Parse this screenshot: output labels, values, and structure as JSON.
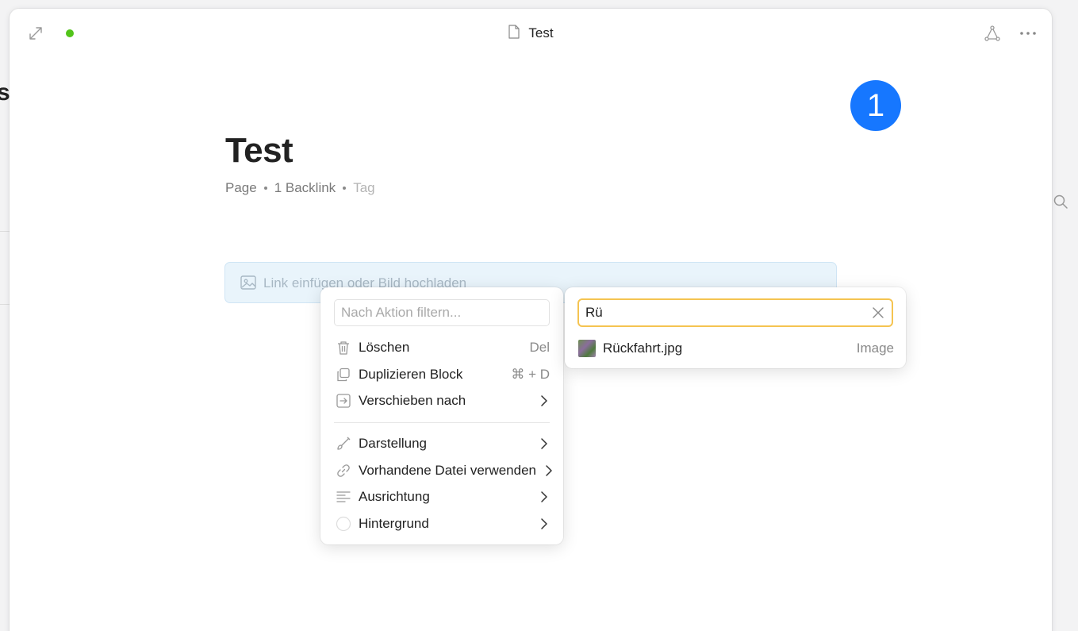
{
  "background": {
    "left_fragment": "st"
  },
  "window": {
    "title": "Test",
    "icons": {
      "expand": "expand-icon",
      "document": "document-icon",
      "graph": "graph-icon",
      "more": "more-icon"
    },
    "sync_status_color": "#52c41a"
  },
  "step_badge": "1",
  "page": {
    "title": "Test",
    "meta": {
      "type": "Page",
      "backlinks": "1 Backlink",
      "tag": "Tag"
    }
  },
  "image_block": {
    "placeholder": "Link einfügen oder Bild hochladen"
  },
  "context_menu": {
    "filter_placeholder": "Nach Aktion filtern...",
    "items": [
      {
        "label": "Löschen",
        "shortcut": "Del",
        "icon": "trash-icon"
      },
      {
        "label": "Duplizieren Block",
        "shortcut": "⌘ + D",
        "icon": "duplicate-icon"
      },
      {
        "label": "Verschieben nach",
        "icon": "move-icon"
      },
      {
        "label": "Darstellung",
        "icon": "brush-icon"
      },
      {
        "label": "Vorhandene Datei verwenden",
        "icon": "link-icon"
      },
      {
        "label": "Ausrichtung",
        "icon": "align-icon"
      },
      {
        "label": "Hintergrund",
        "icon": "circle-icon"
      }
    ]
  },
  "file_search": {
    "value": "Rü",
    "results": [
      {
        "name": "Rückfahrt.jpg",
        "type": "Image"
      }
    ]
  },
  "colors": {
    "accent": "#1677ff",
    "focus_border": "#f5c451",
    "image_block_bg": "#e9f4fb"
  }
}
